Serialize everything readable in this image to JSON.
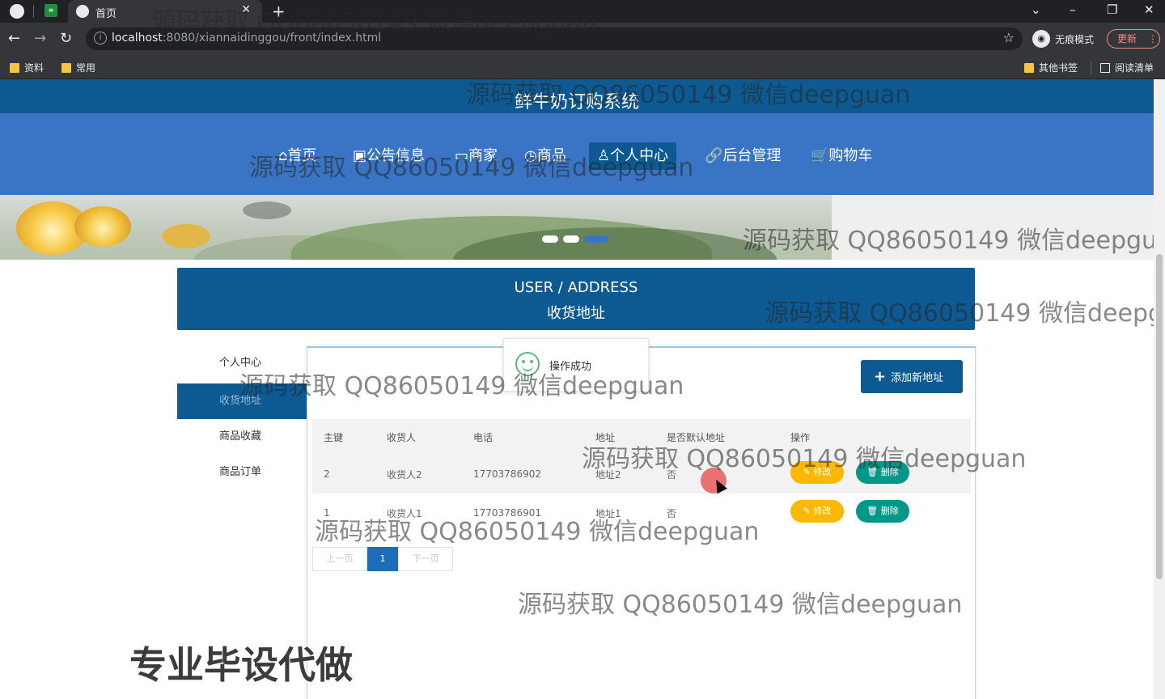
{
  "browser": {
    "tab_title": "首页",
    "url_host": "localhost",
    "url_rest": ":8080/xiannaidinggou/front/index.html",
    "incognito_label": "无痕模式",
    "update_label": "更新",
    "bookmarks": [
      "资料",
      "常用"
    ],
    "other_bookmarks": "其他书签",
    "reading_list": "阅读清单"
  },
  "site": {
    "title": "鲜牛奶订购系统",
    "nav": [
      "⌂首页",
      "▣公告信息",
      "▭商家",
      "◷商品",
      "♙个人中心",
      "🔗后台管理",
      "🛒购物车"
    ],
    "active_nav_index": 4
  },
  "section": {
    "title_en": "USER / ADDRESS",
    "title_zh": "收货地址"
  },
  "sidebar": {
    "items": [
      "个人中心",
      "收货地址",
      "商品收藏",
      "商品订单"
    ],
    "active_index": 1
  },
  "toolbar": {
    "add_label": "添加新地址"
  },
  "table": {
    "headers": [
      "主键",
      "收货人",
      "电话",
      "地址",
      "是否默认地址",
      "操作"
    ],
    "rows": [
      {
        "id": "2",
        "name": "收货人2",
        "phone": "17703786902",
        "address": "地址2",
        "default": "否"
      },
      {
        "id": "1",
        "name": "收货人1",
        "phone": "17703786901",
        "address": "地址1",
        "default": "否"
      }
    ],
    "edit_label": "修改",
    "delete_label": "删除"
  },
  "pager": {
    "prev": "上一页",
    "current": "1",
    "next": "下一页"
  },
  "toast": {
    "message": "操作成功"
  },
  "overlay": {
    "watermark": "源码获取 QQ86050149 微信deepguan",
    "promo": "专业毕设代做"
  },
  "colors": {
    "header": "#0d5a93",
    "nav": "#3a74c4",
    "edit": "#ffb800",
    "delete": "#009688"
  }
}
